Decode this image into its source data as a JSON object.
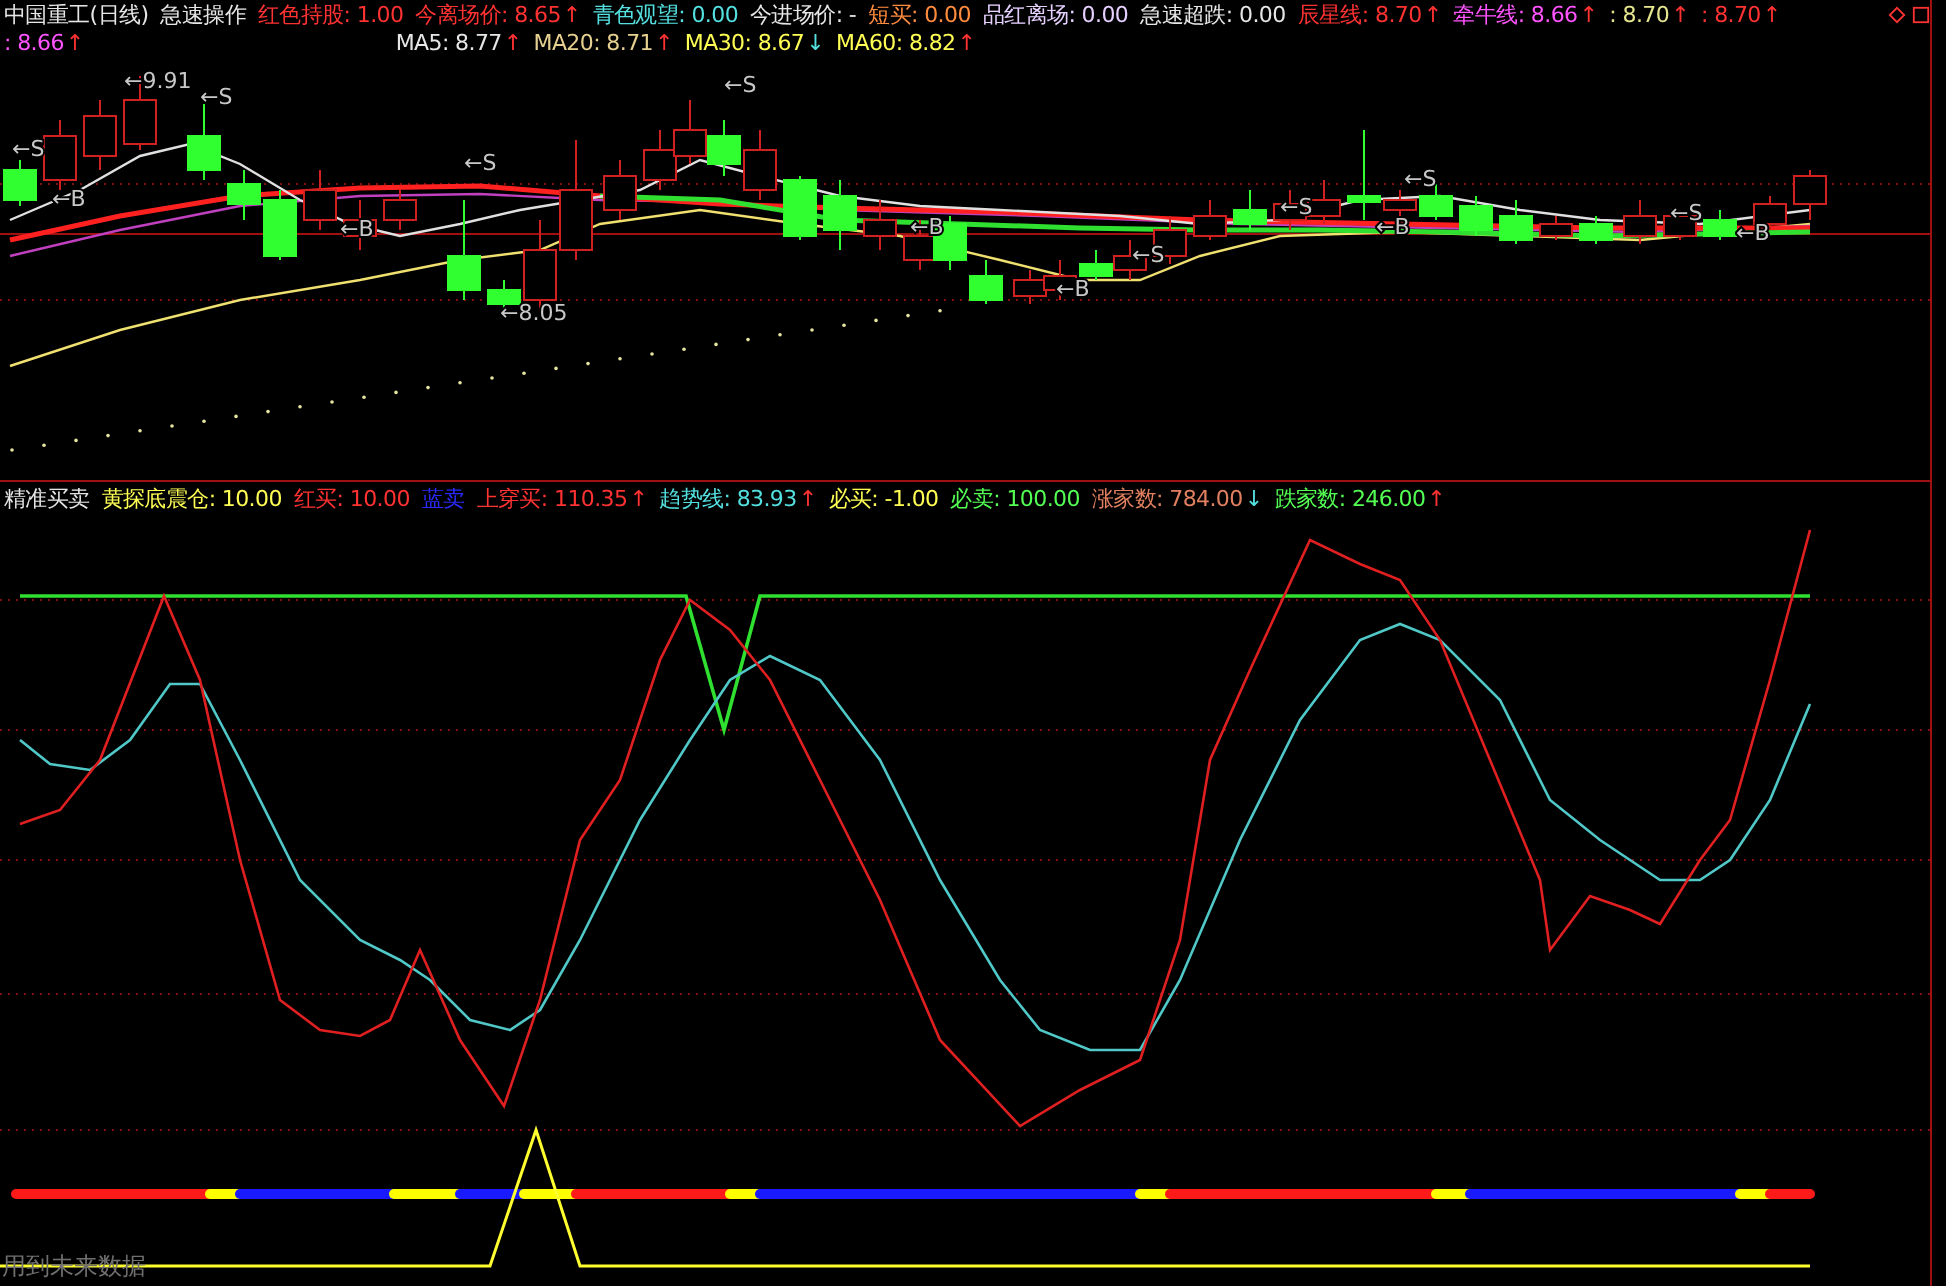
{
  "header": {
    "line1": [
      {
        "text": "中国重工(日线)",
        "color": "#e6e6e6"
      },
      {
        "text": "急速操作",
        "color": "#e6e6e6"
      },
      {
        "text": "红色持股: 1.00",
        "color": "#ff3232"
      },
      {
        "text": "今离场价: 8.65",
        "color": "#ff3232",
        "arrow": {
          "text": "↑",
          "color": "#ff3232"
        }
      },
      {
        "text": "青色观望: 0.00",
        "color": "#54e0e0"
      },
      {
        "text": "今进场价: -",
        "color": "#e6e6e6"
      },
      {
        "text": "短买: 0.00",
        "color": "#ff8c3c"
      },
      {
        "text": "品红离场: 0.00",
        "color": "#e6d0ff"
      },
      {
        "text": "急速超跌: 0.00",
        "color": "#e6e6e6"
      },
      {
        "text": "辰星线: 8.70",
        "color": "#ff3232",
        "arrow": {
          "text": "↑",
          "color": "#ff3232"
        }
      },
      {
        "text": "牵牛线: 8.66",
        "color": "#ff54ff",
        "arrow": {
          "text": "↑",
          "color": "#ff3232"
        }
      },
      {
        "text": ": 8.70",
        "color": "#e6e690",
        "arrow": {
          "text": "↑",
          "color": "#ff3232"
        }
      },
      {
        "text": ": 8.70",
        "color": "#ff3232",
        "arrow": {
          "text": "↑",
          "color": "#ff3232"
        }
      }
    ],
    "line2": [
      {
        "text": ": 8.66",
        "color": "#ff54ff",
        "arrow": {
          "text": "↑",
          "color": "#ff3232"
        }
      },
      {
        "text": "MA5: 8.77",
        "color": "#e6e6e6",
        "arrow": {
          "text": "↑",
          "color": "#ff3232"
        }
      },
      {
        "text": "MA20: 8.71",
        "color": "#e6d090",
        "arrow": {
          "text": "↑",
          "color": "#ff3232"
        }
      },
      {
        "text": "MA30: 8.67",
        "color": "#ffff54",
        "arrow": {
          "text": "↓",
          "color": "#54e0e0"
        }
      },
      {
        "text": "MA60: 8.82",
        "color": "#ffff54",
        "arrow": {
          "text": "↑",
          "color": "#ff3232"
        }
      }
    ]
  },
  "top_chart": {
    "marks": [
      "←9.91",
      "←S",
      "←S",
      "←B",
      "←B",
      "←S",
      "←8.05",
      "←S",
      "←B",
      "←B",
      "←S",
      "←S",
      "←S",
      "←B",
      "←S",
      "←B"
    ]
  },
  "lower_header": [
    {
      "text": "精准买卖",
      "color": "#e6e6e6"
    },
    {
      "text": "黄探底震仓: 10.00",
      "color": "#ffff54"
    },
    {
      "text": "红买: 10.00",
      "color": "#ff3232"
    },
    {
      "text": "蓝卖",
      "color": "#2a2aff"
    },
    {
      "text": "上穿买: 110.35",
      "color": "#ff3232",
      "arrow": {
        "text": "↑",
        "color": "#ff3232"
      }
    },
    {
      "text": "趋势线: 83.93",
      "color": "#54e0e0",
      "arrow": {
        "text": "↑",
        "color": "#ff3232"
      }
    },
    {
      "text": "必买: -1.00",
      "color": "#ffff54"
    },
    {
      "text": "必卖: 100.00",
      "color": "#54ff54"
    },
    {
      "text": "涨家数: 784.00",
      "color": "#e08060",
      "arrow": {
        "text": "↓",
        "color": "#54e0e0"
      }
    },
    {
      "text": "跌家数: 246.00",
      "color": "#54ff54",
      "arrow": {
        "text": "↑",
        "color": "#ff3232"
      }
    }
  ],
  "lower_chart": {
    "note": "用到未来数据"
  }
}
